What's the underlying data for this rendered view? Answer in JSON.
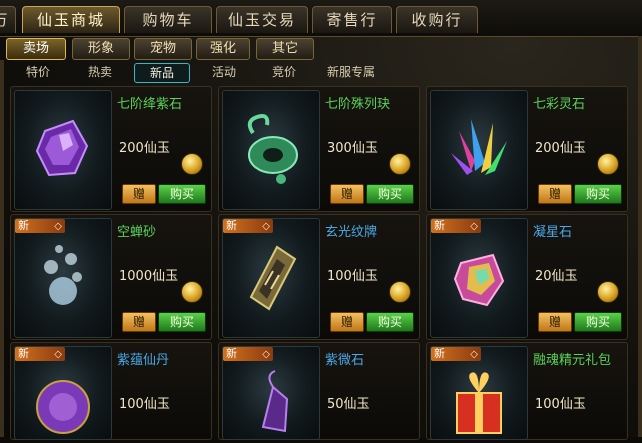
{
  "top_tabs": [
    "万",
    "仙玉商城",
    "购物车",
    "仙玉交易",
    "寄售行",
    "收购行"
  ],
  "sub_tabs": [
    "卖场",
    "形象",
    "宠物",
    "强化",
    "其它"
  ],
  "filters": [
    "特价",
    "热卖",
    "新品",
    "活动",
    "竞价",
    "新服专属"
  ],
  "new_tag": "新",
  "buttons": {
    "gift": "赠",
    "buy": "购买"
  },
  "items": [
    {
      "name": "七阶绛紫石",
      "price": "200仙玉",
      "is_new": false
    },
    {
      "name": "七阶殊列玦",
      "price": "300仙玉",
      "is_new": false
    },
    {
      "name": "七彩灵石",
      "price": "200仙玉",
      "is_new": false
    },
    {
      "name": "空蝉砂",
      "price": "1000仙玉",
      "is_new": true
    },
    {
      "name": "玄光纹牌",
      "price": "100仙玉",
      "is_new": true
    },
    {
      "name": "凝星石",
      "price": "20仙玉",
      "is_new": true
    },
    {
      "name": "紫蕴仙丹",
      "price": "100仙玉",
      "is_new": true
    },
    {
      "name": "紫微石",
      "price": "50仙玉",
      "is_new": true
    },
    {
      "name": "融魂精元礼包",
      "price": "100仙玉",
      "is_new": true
    }
  ]
}
